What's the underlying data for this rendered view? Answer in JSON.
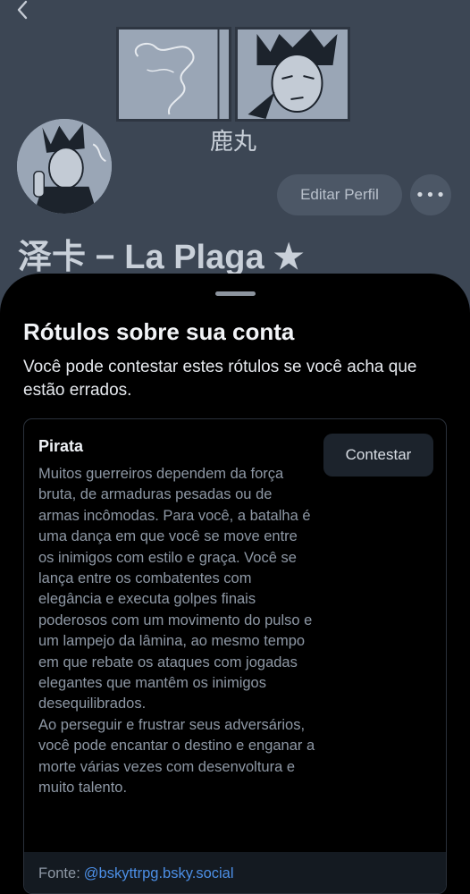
{
  "profile": {
    "banner_caption": "鹿丸",
    "edit_profile_label": "Editar Perfil",
    "more_label": "•••",
    "display_name": "泽卡 − La Plaga ★"
  },
  "sheet": {
    "title": "Rótulos sobre sua conta",
    "subtitle": "Você pode contestar estes rótulos se você acha que estão errados.",
    "label": {
      "name": "Pirata",
      "description_p1": "Muitos guerreiros dependem da força bruta, de armaduras pesadas ou de armas incômodas. Para você, a batalha é uma dança em que você se move entre os inimigos com estilo e graça. Você se lança entre os combatentes com elegância e executa golpes finais poderosos com um movimento do pulso e um lampejo da lâmina, ao mesmo tempo em que rebate os ataques com jogadas elegantes que mantêm os inimigos desequilibrados.",
      "description_p2": "Ao perseguir e frustrar seus adversários, você pode encantar o destino e enganar a morte várias vezes com desenvoltura e muito talento.",
      "contest_label": "Contestar",
      "source_prefix": "Fonte:",
      "source_handle": "@bskyttrpg.bsky.social"
    }
  },
  "colors": {
    "link": "#4c8fe6",
    "sheet_bg": "#000000",
    "profile_bg": "#3c4654"
  },
  "icons": {
    "back": "chevron-left-icon",
    "more": "ellipsis-icon"
  }
}
